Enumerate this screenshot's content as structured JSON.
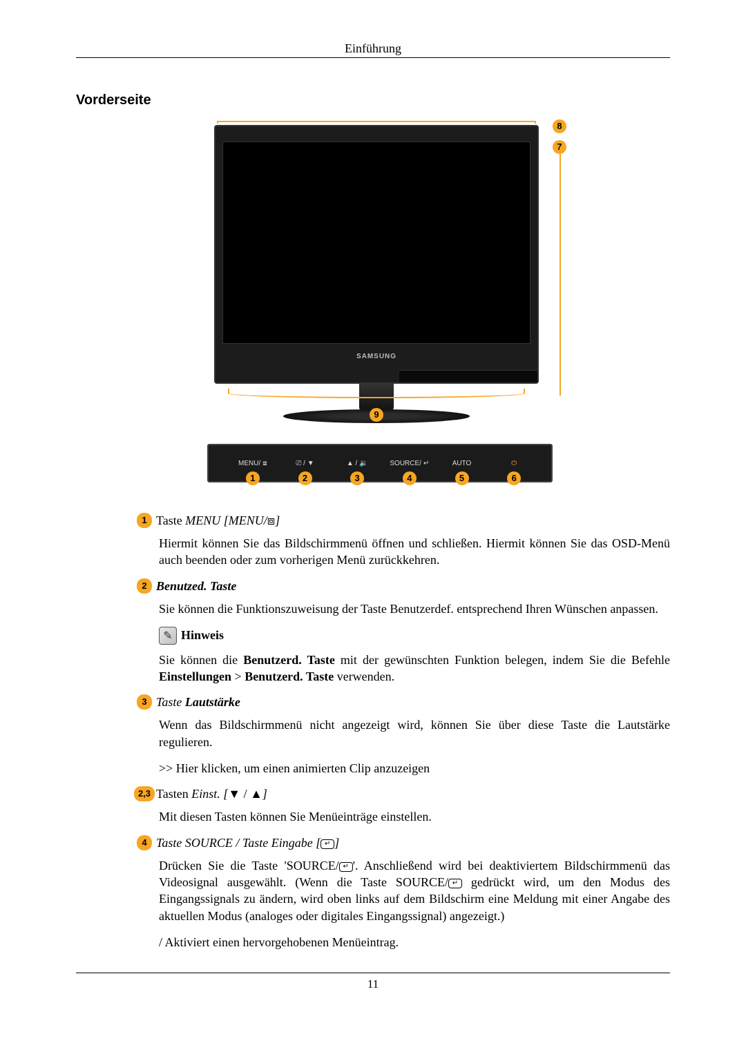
{
  "header": "Einführung",
  "section_title": "Vorderseite",
  "figure": {
    "brand": "SAMSUNG",
    "buttons": [
      {
        "num": "1",
        "label": "MENU/",
        "glyph": "⧈"
      },
      {
        "num": "2",
        "label": "",
        "glyph": "⎚ / ▼"
      },
      {
        "num": "3",
        "label": "",
        "glyph": "▲ / 🔉"
      },
      {
        "num": "4",
        "label": "SOURCE/",
        "glyph": "↵"
      },
      {
        "num": "5",
        "label": "AUTO",
        "glyph": ""
      },
      {
        "num": "6",
        "label": "",
        "glyph": "⏻"
      }
    ],
    "badge7": "7",
    "badge8": "8",
    "badge9": "9"
  },
  "items": [
    {
      "badge": "1",
      "title_prefix": "Taste ",
      "title_italic": "MENU [MENU/",
      "title_suffix_glyph": "⧈",
      "title_close": "]",
      "paragraphs": [
        "Hiermit können Sie das Bildschirmmenü öffnen und schließen. Hiermit können Sie das OSD-Menü auch beenden oder zum vorherigen Menü zurückkehren."
      ]
    },
    {
      "badge": "2",
      "title_bold_italic": "Benutzed. Taste",
      "paragraphs": [
        "Sie können die Funktionszuweisung der Taste Benutzerdef. entsprechend Ihren Wünschen anpassen."
      ],
      "hinweis": true,
      "hinweis_label": "Hinweis",
      "hinweis_text_parts": [
        "Sie können die ",
        "Benutzerd. Taste",
        "  mit der gewünschten Funktion belegen, indem Sie die Befehle ",
        "Einstellungen",
        " > ",
        "Benutzerd. Taste",
        " verwenden."
      ]
    },
    {
      "badge": "3",
      "title_prefix": "Taste ",
      "title_bold_italic": "Lautstärke",
      "paragraphs": [
        "Wenn das Bildschirmmenü nicht angezeigt wird, können Sie über diese Taste die Lautstärke regulieren.",
        ">> Hier klicken, um einen animierten Clip anzuzeigen"
      ]
    },
    {
      "badge": "2,3",
      "title_prefix": "Tasten ",
      "title_italic": "Einst. [",
      "arrows": true,
      "title_close": "]",
      "paragraphs": [
        "Mit diesen Tasten können Sie Menüeinträge einstellen."
      ]
    },
    {
      "badge": "4",
      "title_italic": "Taste SOURCE / Taste Eingabe [",
      "enter_icon": true,
      "title_close": "]",
      "source_paragraph": {
        "p1a": "Drücken Sie die Taste 'SOURCE/",
        "p1b": "'. Anschließend wird bei deaktiviertem Bildschirmmenü das Videosignal ausgewählt. (Wenn die Taste SOURCE/",
        "p1c": " gedrückt wird, um den Modus des Eingangssignals zu ändern, wird oben links auf dem Bildschirm eine Meldung mit einer Angabe des aktuellen Modus (analoges oder digitales Eingangssignal) angezeigt.)"
      },
      "paragraphs2": [
        "/ Aktiviert einen hervorgehobenen Menüeintrag."
      ]
    }
  ],
  "page_number": "11"
}
